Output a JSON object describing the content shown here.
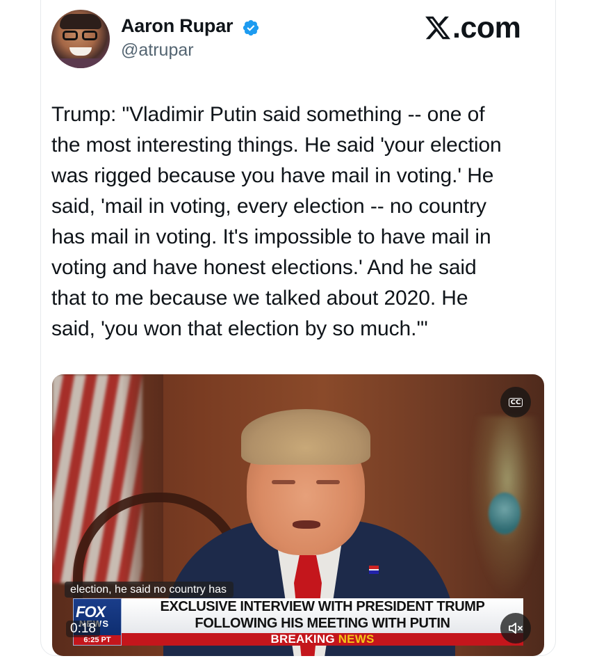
{
  "author": {
    "name": "Aaron Rupar",
    "handle": "@atrupar",
    "verified": true,
    "verified_color": "#1d9bf0"
  },
  "brand": {
    "logo_icon": "x-logo-icon",
    "dotcom": ".com"
  },
  "tweet": {
    "text": "Trump: \"Vladimir Putin said something -- one of\nthe most interesting things. He said 'your election\nwas rigged because you have mail in voting.' He\nsaid, 'mail in voting, every election -- no country\nhas mail in voting. It's impossible to have mail in\nvoting and have honest elections.' And he said\nthat to me because we talked about 2020. He\nsaid, 'you won that election by so much.'\""
  },
  "video": {
    "caption_text": "election, he said no country has",
    "timestamp": "0:18",
    "cc_label": "CC",
    "mute_icon": "speaker-muted-icon",
    "lower_third": {
      "network": "FOX",
      "network_sub": "NEWS",
      "clock": "6:25 PT",
      "headline_line1": "EXCLUSIVE INTERVIEW WITH PRESIDENT TRUMP",
      "headline_line2": "FOLLOWING HIS MEETING WITH PUTIN",
      "breaking_word": "BREAKING",
      "news_word": "NEWS"
    }
  },
  "colors": {
    "text_primary": "#0f1419",
    "text_secondary": "#536471",
    "breaking_red": "#c4161c",
    "news_yellow": "#f5c518"
  }
}
